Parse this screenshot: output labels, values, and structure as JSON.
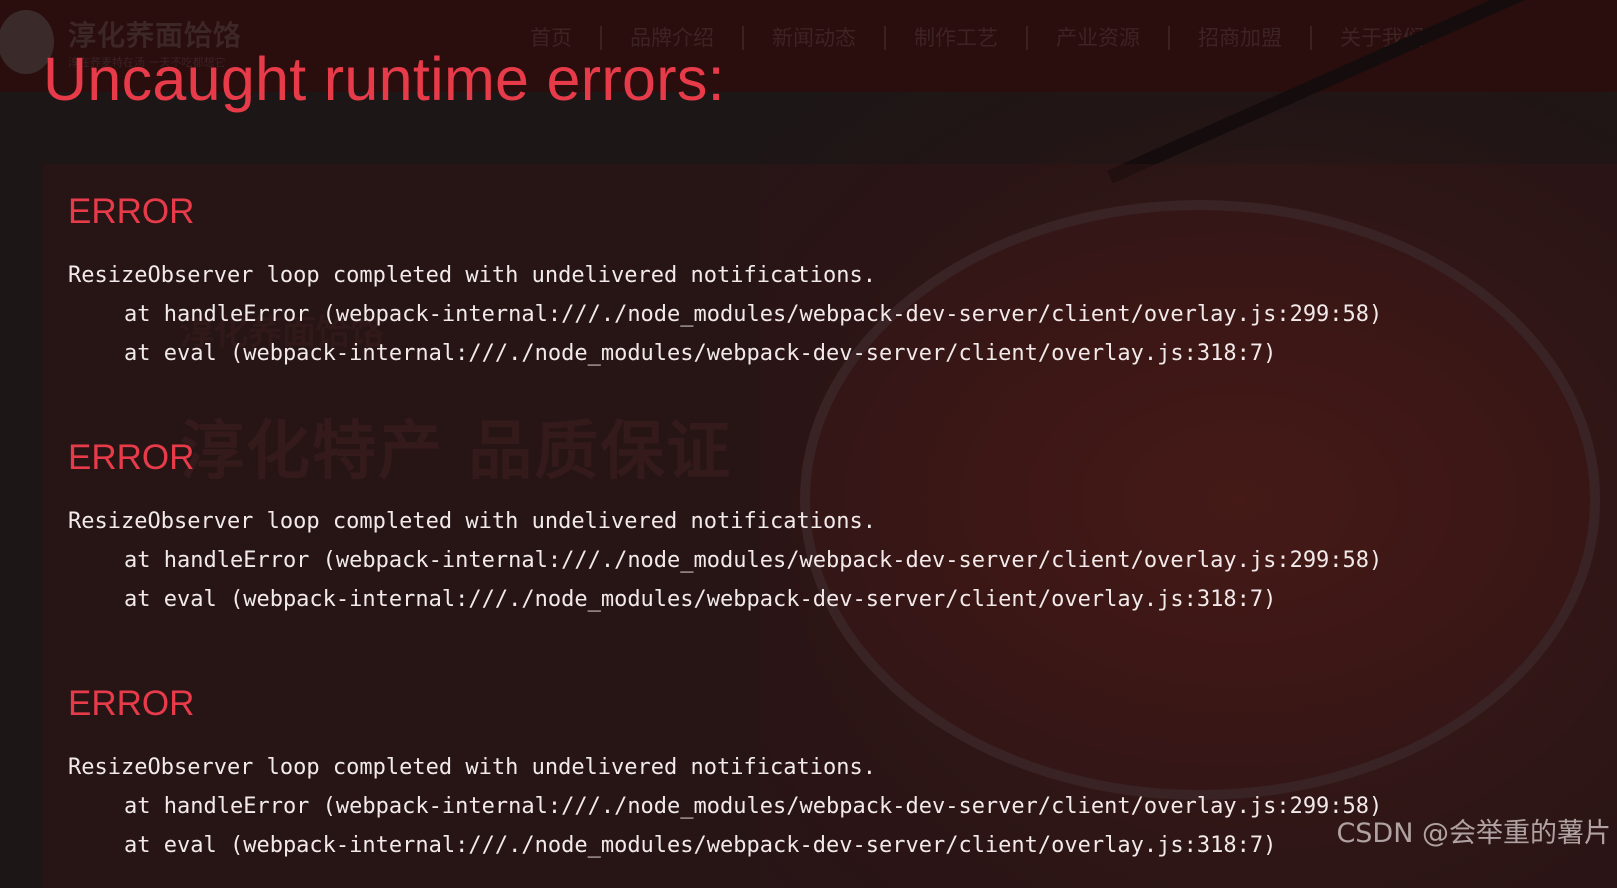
{
  "site": {
    "logo_text": "淳化荞面饸饹",
    "logo_tagline": "淳在荞麦特在汤 一天不吃都想它",
    "nav": [
      "首页",
      "品牌介绍",
      "新闻动态",
      "制作工艺",
      "产业资源",
      "招商加盟",
      "关于我们"
    ],
    "hero_brand": "淳化荞面饸饹",
    "hero_title": "淳化特产 品质保证"
  },
  "overlay": {
    "title": "Uncaught runtime errors:",
    "errors": [
      {
        "label": "ERROR",
        "message": "ResizeObserver loop completed with undelivered notifications.",
        "stack": [
          "at handleError (webpack-internal:///./node_modules/webpack-dev-server/client/overlay.js:299:58)",
          "at eval (webpack-internal:///./node_modules/webpack-dev-server/client/overlay.js:318:7)"
        ]
      },
      {
        "label": "ERROR",
        "message": "ResizeObserver loop completed with undelivered notifications.",
        "stack": [
          "at handleError (webpack-internal:///./node_modules/webpack-dev-server/client/overlay.js:299:58)",
          "at eval (webpack-internal:///./node_modules/webpack-dev-server/client/overlay.js:318:7)"
        ]
      },
      {
        "label": "ERROR",
        "message": "ResizeObserver loop completed with undelivered notifications.",
        "stack": [
          "at handleError (webpack-internal:///./node_modules/webpack-dev-server/client/overlay.js:299:58)",
          "at eval (webpack-internal:///./node_modules/webpack-dev-server/client/overlay.js:318:7)"
        ]
      }
    ]
  },
  "watermark": "CSDN @会举重的薯片",
  "colors": {
    "error_red": "#e83b4a",
    "text": "#f2eaea",
    "header_bg": "#2a0d0d"
  }
}
